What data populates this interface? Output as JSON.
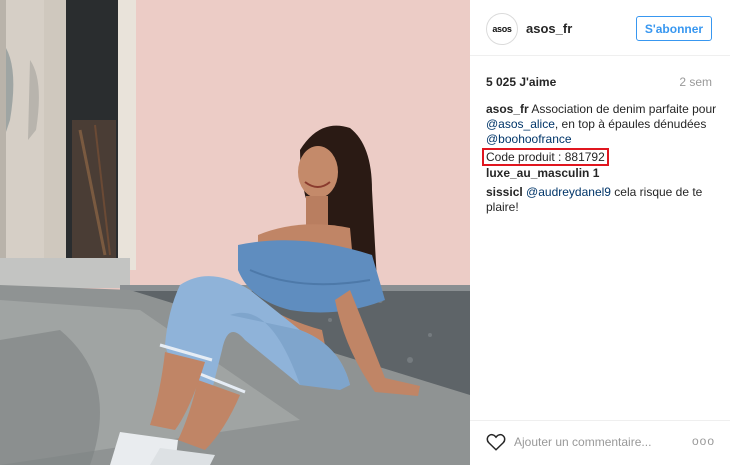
{
  "post": {
    "photo_alt": "",
    "likes": "5 025 J'aime",
    "time": "2 sem"
  },
  "header": {
    "avatar_text": "asos",
    "username": "asos_fr",
    "follow_label": "S'abonner"
  },
  "caption": {
    "username": "asos_fr",
    "text": "Association de denim parfaite pour",
    "mention1": "@asos_alice",
    "text2": ", en top à épaules dénudées",
    "mention2": "@boohoofrance",
    "product_code": "Code produit : 881792"
  },
  "comments": [
    {
      "username": "luxe_au_masculin 1",
      "text": ""
    },
    {
      "username": "sissicl",
      "mention": "@audreydanel9",
      "text": " cela risque de te plaire!"
    }
  ],
  "footer": {
    "comment_placeholder": "Ajouter un commentaire...",
    "more_label": "ooo"
  },
  "colors": {
    "accent": "#3897f0",
    "highlight_box": "#e0161f",
    "mention": "#003569"
  },
  "icons": {
    "like": "heart-icon",
    "options": "more-options-icon"
  }
}
